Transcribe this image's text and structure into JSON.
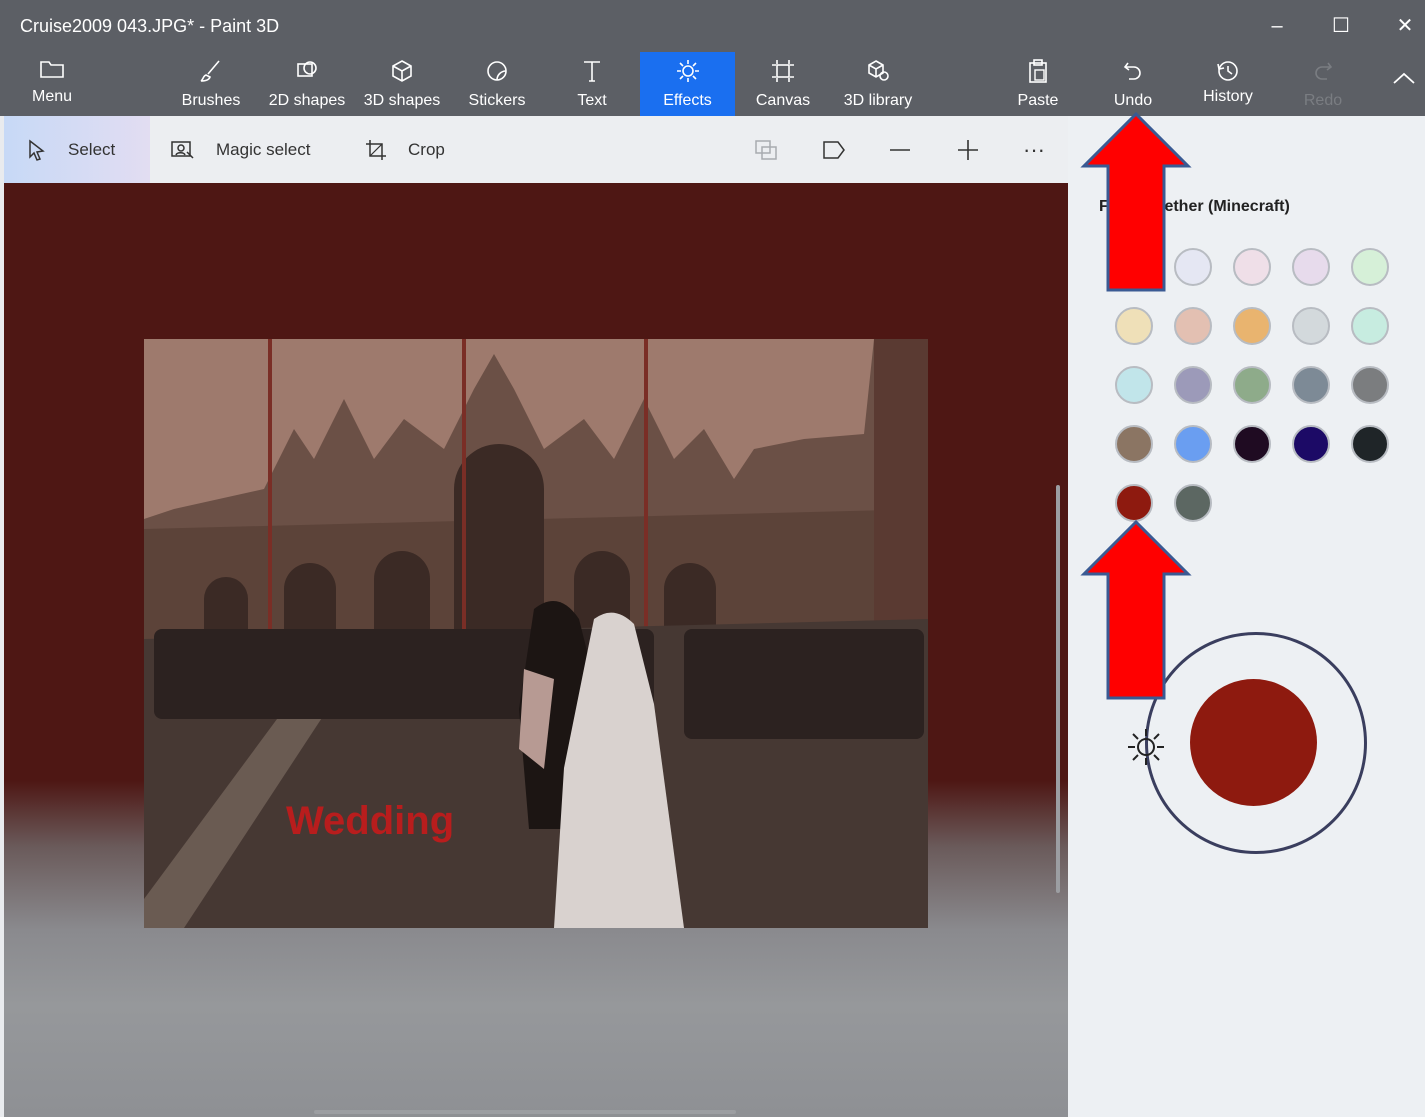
{
  "window": {
    "title": "Cruise2009 043.JPG* - Paint 3D",
    "minimize": "–",
    "maximize": "☐",
    "close": "✕"
  },
  "ribbon": {
    "menu": "Menu",
    "brushes": "Brushes",
    "shapes2d": "2D shapes",
    "shapes3d": "3D shapes",
    "stickers": "Stickers",
    "text": "Text",
    "effects": "Effects",
    "canvas": "Canvas",
    "library3d": "3D library",
    "paste": "Paste",
    "undo": "Undo",
    "history": "History",
    "redo": "Redo",
    "collapse": "^"
  },
  "toolbar": {
    "select": "Select",
    "magic_select": "Magic select",
    "crop": "Crop",
    "more": "···"
  },
  "image": {
    "overlay_text": "Wedding"
  },
  "panel": {
    "palette_title_visible": "lether (Minecraft)",
    "palette_title_prefix": "F",
    "selected_color": "#8e1a0f",
    "swatches": [
      [
        "#e5e7f3",
        "#efdfe8",
        "#e7dbec",
        "#d6f0d8"
      ],
      [
        "#efe0b8",
        "#e3c0b2",
        "#e9b46f",
        "#d3d9dc",
        "#c7ece0"
      ],
      [
        "#c1e5ea",
        "#9c9ab9",
        "#8eab8a",
        "#7d8a96",
        "#7b7d7f"
      ],
      [
        "#8b7563",
        "#6a9ef1",
        "#1f0b22",
        "#1c0a66",
        "#1f2528"
      ],
      [
        "#8e1a0f",
        "#5c6762"
      ]
    ]
  },
  "colors": {
    "accent": "#1a6ff0",
    "ribbon_bg": "#5c5f65",
    "arrow_fill": "#ff0000",
    "arrow_outline": "#3a5a93"
  }
}
